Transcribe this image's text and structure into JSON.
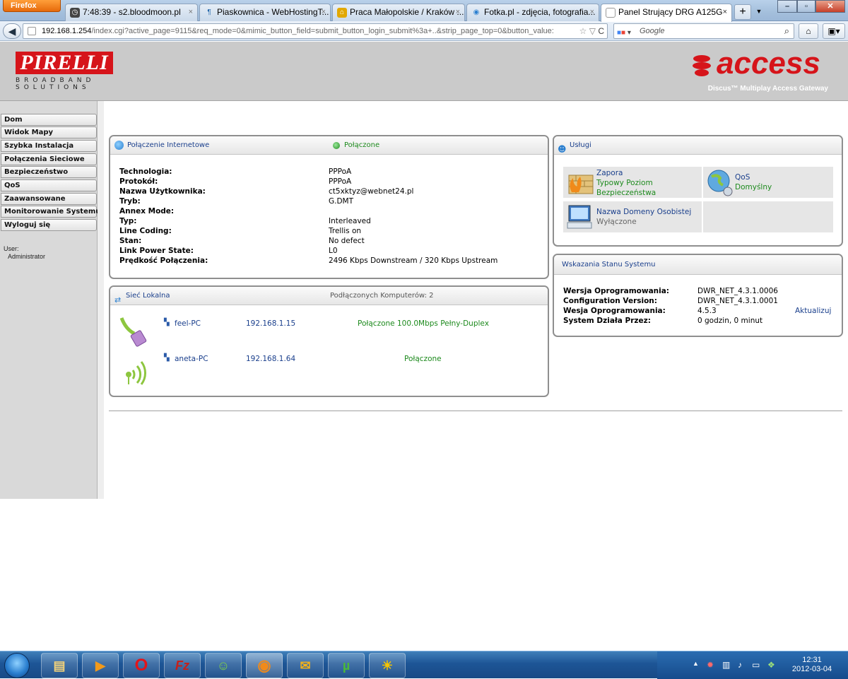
{
  "browser": {
    "app_button": "Firefox",
    "tabs": [
      {
        "label": "7:48:39 - s2.bloodmoon.pl"
      },
      {
        "label": "Piaskownica - WebHostingT..."
      },
      {
        "label": "Praca Małopolskie / Kraków ..."
      },
      {
        "label": "Fotka.pl - zdjęcia, fotografia..."
      },
      {
        "label": "Panel Strujący DRG A125G"
      }
    ],
    "url_host": "192.168.1.254",
    "url_path": "/index.cgi?active_page=9115&req_mode=0&mimic_button_field=submit_button_login_submit%3a+..&strip_page_top=0&button_value:",
    "search_placeholder": "Google"
  },
  "header": {
    "logo_left": "PIRELLI",
    "logo_left_sub": "BROADBAND SOLUTIONS",
    "logo_right": "access",
    "logo_right_sub": "Discus™ Multiplay Access Gateway",
    "colors": {
      "brand": "#d6141a",
      "header_bg": "#cacaca"
    }
  },
  "sidebar": {
    "items": [
      {
        "label": "Dom"
      },
      {
        "label": "Widok Mapy"
      },
      {
        "label": "Szybka Instalacja"
      },
      {
        "label": "Połączenia Sieciowe"
      },
      {
        "label": "Bezpieczeństwo"
      },
      {
        "label": "QoS"
      },
      {
        "label": "Zaawansowane"
      },
      {
        "label": "Monitorowanie Systemu"
      },
      {
        "label": "Wyloguj się"
      }
    ],
    "user_label": "User:",
    "user_name": "Administrator"
  },
  "internet": {
    "title": "Połączenie Internetowe",
    "status": "Połączone",
    "rows": [
      {
        "key": "Technologia:",
        "value": "PPPoA"
      },
      {
        "key": "Protokół:",
        "value": "PPPoA"
      },
      {
        "key": "Nazwa Użytkownika:",
        "value": "ct5xktyz@webnet24.pl"
      },
      {
        "key": "Tryb:",
        "value": "G.DMT"
      },
      {
        "key": "Annex Mode:",
        "value": ""
      },
      {
        "key": "Typ:",
        "value": "Interleaved"
      },
      {
        "key": "Line Coding:",
        "value": "Trellis on"
      },
      {
        "key": "Stan:",
        "value": "No defect"
      },
      {
        "key": "Link Power State:",
        "value": "L0"
      },
      {
        "key": "Prędkość Połączenia:",
        "value": "2496 Kbps Downstream / 320 Kbps Upstream"
      }
    ]
  },
  "lan": {
    "title": "Sieć Lokalna",
    "summary": "Podłączonych Komputerów: 2",
    "devices": [
      {
        "name": "feel-PC",
        "ip": "192.168.1.15",
        "status": "Połączone 100.0Mbps Pełny-Duplex"
      },
      {
        "name": "aneta-PC",
        "ip": "192.168.1.64",
        "status": "Połączone"
      }
    ]
  },
  "services": {
    "title": "Usługi",
    "items": [
      {
        "name": "Zapora",
        "status": "Typowy Poziom Bezpieczeństwa",
        "status_line1": "Typowy Poziom",
        "status_line2": "Bezpieczeństwa"
      },
      {
        "name": "QoS",
        "status": "Domyślny"
      },
      {
        "name": "Nazwa Domeny Osobistej",
        "status": "Wyłączone"
      }
    ]
  },
  "system": {
    "title": "Wskazania Stanu Systemu",
    "rows": [
      {
        "key": "Wersja Oprogramowania:",
        "value": "DWR_NET_4.3.1.0006"
      },
      {
        "key": "Configuration Version:",
        "value": "DWR_NET_4.3.1.0001"
      },
      {
        "key": "Wesja Oprogramowania:",
        "value": "4.5.3"
      },
      {
        "key": "System Działa Przez:",
        "value": "0 godzin, 0 minut"
      }
    ],
    "update_link": "Aktualizuj"
  },
  "taskbar": {
    "time": "12:31",
    "date": "2012-03-04"
  }
}
